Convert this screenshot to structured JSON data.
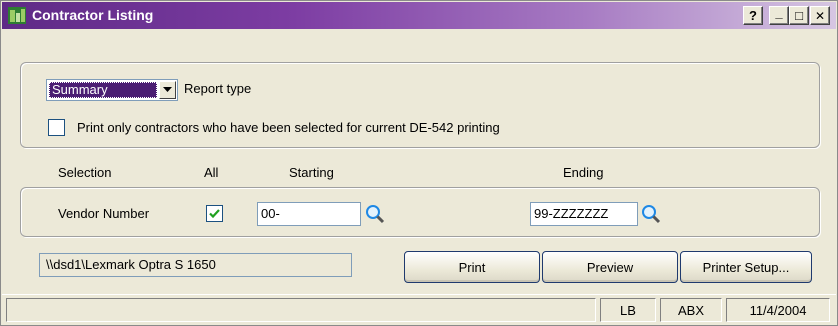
{
  "window": {
    "title": "Contractor Listing"
  },
  "title_buttons": {
    "help": "?",
    "minimize": "_",
    "maximize": "□",
    "close": "✕"
  },
  "report": {
    "type_value": "Summary",
    "type_label": "Report type",
    "print_only_label": "Print only contractors who have been selected for current DE-542 printing",
    "print_only_checked": false
  },
  "selection": {
    "header_selection": "Selection",
    "header_all": "All",
    "header_starting": "Starting",
    "header_ending": "Ending",
    "row_label": "Vendor Number",
    "all_checked": true,
    "starting_value": "00-",
    "ending_value": "99-ZZZZZZZ"
  },
  "printer": {
    "path": "\\\\dsd1\\Lexmark Optra S 1650"
  },
  "buttons": {
    "print": "Print",
    "preview": "Preview",
    "printer_setup": "Printer Setup..."
  },
  "status": {
    "user": "LB",
    "company": "ABX",
    "date": "11/4/2004"
  },
  "colors": {
    "title_start": "#5e2a86",
    "selection_highlight": "#4b1d73",
    "check_green": "#21a121"
  }
}
